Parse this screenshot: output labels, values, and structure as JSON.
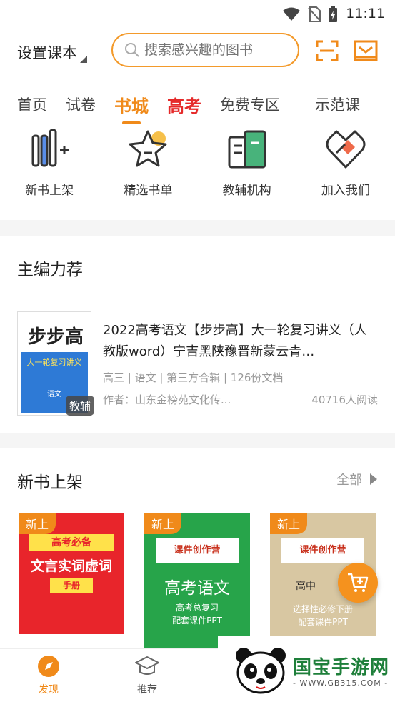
{
  "status": {
    "time": "11:11"
  },
  "header": {
    "textbook_setting": "设置课本",
    "search_placeholder": "搜索感兴趣的图书"
  },
  "tabs": [
    {
      "label": "首页"
    },
    {
      "label": "试卷"
    },
    {
      "label": "书城"
    },
    {
      "label": "高考"
    },
    {
      "label": "免费专区"
    },
    {
      "label": "示范课"
    }
  ],
  "quick_links": [
    {
      "label": "新书上架",
      "icon": "new-books-icon"
    },
    {
      "label": "精选书单",
      "icon": "star-list-icon"
    },
    {
      "label": "教辅机构",
      "icon": "institution-icon"
    },
    {
      "label": "加入我们",
      "icon": "join-us-icon"
    }
  ],
  "recommend": {
    "title": "主编力荐",
    "book": {
      "title": "2022高考语文【步步高】大一轮复习讲义（人教版word）宁吉黑陕豫晋新蒙云青…",
      "meta": "高三 | 语文 | 第三方合辑 | 126份文档",
      "author": "作者：山东金榜苑文化传...",
      "reads": "40716人阅读",
      "cover_tag": "教辅",
      "cover_title": "大一轮复习讲义",
      "cover_brand": "步步高",
      "cover_subject": "语文"
    }
  },
  "new_books": {
    "title": "新书上架",
    "see_all": "全部",
    "badge": "新上",
    "items": [
      {
        "line1": "高考必备",
        "line2": "文言实词虚词",
        "line3": "手册"
      },
      {
        "brand": "课件创作营",
        "line1": "高考语文",
        "line2": "高考总复习",
        "line3": "配套课件PPT"
      },
      {
        "brand": "课件创作营",
        "line1": "高中",
        "line2": "选择性必修下册",
        "line3": "配套课件PPT"
      }
    ]
  },
  "bottom_nav": [
    {
      "label": "发现"
    },
    {
      "label": "推荐"
    }
  ],
  "watermark": {
    "text": "国宝手游网",
    "url": "- WWW.GB315.COM -"
  },
  "colors": {
    "accent": "#f08a1a",
    "hot": "#e52a2a",
    "green": "#1e7f3a"
  }
}
